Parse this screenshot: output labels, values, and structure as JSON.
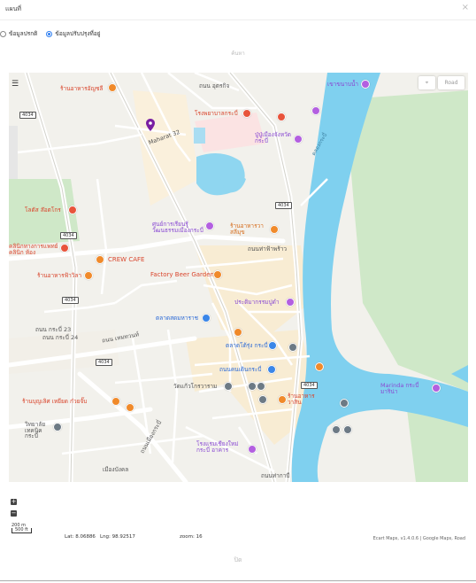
{
  "modal": {
    "title": "แผนที่",
    "close_label": "×",
    "ok_label": "ปิด"
  },
  "radio_options": [
    {
      "label": "ข้อมูลปรกติ",
      "selected": false
    },
    {
      "label": "ข้อมูลปรับปรุงที่อยู่",
      "selected": true
    }
  ],
  "search_label": "ค้นหา",
  "map": {
    "road_label": "Road",
    "layers_icon": "layers-icon",
    "locate_icon": "locate-icon",
    "marker_icon": "location-pin-icon",
    "labels": [
      {
        "text": "ร้านอาหารอัญชลี",
        "kind": "r"
      },
      {
        "text": "โรงพยาบาลกระบี่",
        "kind": "r"
      },
      {
        "text": "ปู่ปู่เมืองจังหวัดกระบี่",
        "kind": "p"
      },
      {
        "text": "เขาขนาบน้ำ",
        "kind": "p"
      },
      {
        "text": "Maharat 32",
        "kind": "g"
      },
      {
        "text": "ถนน อุตรกิจ",
        "kind": "g"
      },
      {
        "text": "โลตัส ล๊อตโกร",
        "kind": "r"
      },
      {
        "text": "ศูนย์การเรียนรู้วัฒนธรรมเมืองกระบี่",
        "kind": "p"
      },
      {
        "text": "ร้านอาหารวาสลีมุข",
        "kind": "o"
      },
      {
        "text": "ถนนท่าฟ้าพร้าว",
        "kind": "g"
      },
      {
        "text": "CREW CAFE",
        "kind": "r"
      },
      {
        "text": "คลินิกทางการแพทย์ คลินิก ห้อง",
        "kind": "r"
      },
      {
        "text": "ร้านอาหารฟ้าวิลา",
        "kind": "r"
      },
      {
        "text": "Factory Beer Garden",
        "kind": "r"
      },
      {
        "text": "ประติมากรรมปูดำ",
        "kind": "p"
      },
      {
        "text": "ตลาดสดมหาราช",
        "kind": "b"
      },
      {
        "text": "ถนน กระบี่ 23",
        "kind": "g"
      },
      {
        "text": "ถนน กระบี่ 24",
        "kind": "g"
      },
      {
        "text": "ถนน เหมทวนท์",
        "kind": "g"
      },
      {
        "text": "ตลาดโต้รุ่ง กระบี่",
        "kind": "b"
      },
      {
        "text": "ถนนคนเดินกระบี่",
        "kind": "b"
      },
      {
        "text": "วัดแก้วโกรวาราม",
        "kind": "g"
      },
      {
        "text": "ร้านอาหารวาสิน",
        "kind": "r"
      },
      {
        "text": "ร้านบุญเลิศ เหยียด ก๋วยจั๊บ",
        "kind": "r"
      },
      {
        "text": "วิทยาลัยเทคนิคกระบี่",
        "kind": "g"
      },
      {
        "text": "Marinda กระบี่ มาริน่า",
        "kind": "p"
      },
      {
        "text": "โรงแรมเชียงใหม่ กระบี่ อาคาร",
        "kind": "p"
      },
      {
        "text": "เมืองบังคล",
        "kind": "g"
      },
      {
        "text": "คลองกระบี่",
        "kind": "w"
      },
      {
        "text": "ถนนท่ากาบี",
        "kind": "g"
      },
      {
        "text": "ถนนเมืองกระบี่",
        "kind": "g"
      }
    ],
    "road_shields": [
      "4034",
      "4034",
      "4034",
      "4034",
      "4034",
      "4034"
    ]
  },
  "zoom": {
    "in_label": "+",
    "out_label": "−"
  },
  "scale": {
    "top": "200 m",
    "bottom": "500 ft"
  },
  "status": {
    "lat_label": "Lat: 8.06886",
    "lng_label": "Lng: 98.92517",
    "zoom_label": "zoom: 16"
  },
  "attribution": "Ecart Maps, v1.4.0.6 | Google Maps, Road"
}
